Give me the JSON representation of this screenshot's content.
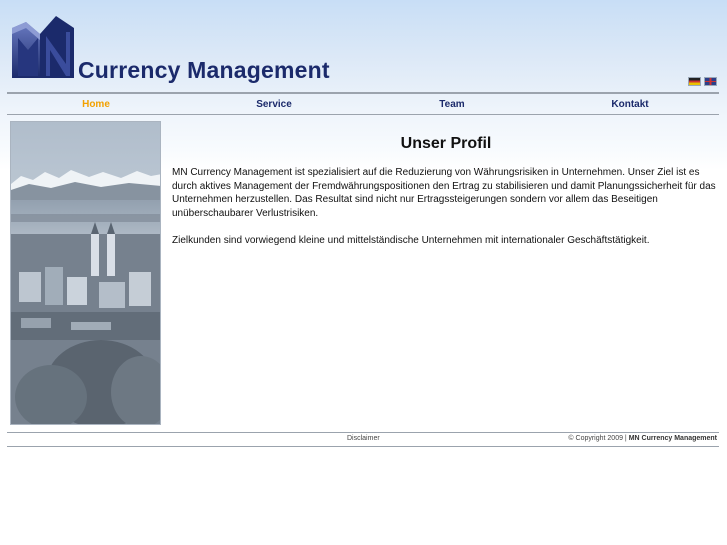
{
  "header": {
    "logo_initials": "MN",
    "logo_text": "Currency Management",
    "languages": [
      "Deutsch",
      "English"
    ]
  },
  "nav": {
    "items": [
      {
        "label": "Home",
        "active": true
      },
      {
        "label": "Service",
        "active": false
      },
      {
        "label": "Team",
        "active": false
      },
      {
        "label": "Kontakt",
        "active": false
      }
    ]
  },
  "main": {
    "title": "Unser Profil",
    "paragraph1": "MN Currency Management ist spezialisiert auf die Reduzierung von Währungsrisiken in Unternehmen. Unser Ziel ist es durch aktives Management der Fremdwährungspositionen den Ertrag zu stabilisieren und damit Planungssicherheit für das Unternehmen herzustellen. Das Resultat sind nicht nur Ertragssteigerungen sondern vor allem das Beseitigen unüberschaubarer Verlustrisiken.",
    "paragraph2": "Zielkunden sind vorwiegend kleine und mittelständische Unternehmen mit internationaler Geschäftstätigkeit."
  },
  "footer": {
    "disclaimer": "Disclaimer",
    "copyright_prefix": "© Copyright 2009 |",
    "copyright_company": "MN Currency Management"
  },
  "colors": {
    "brand_navy": "#1b2a6b",
    "nav_active": "#f2a100",
    "header_blue": "#c8def6"
  }
}
